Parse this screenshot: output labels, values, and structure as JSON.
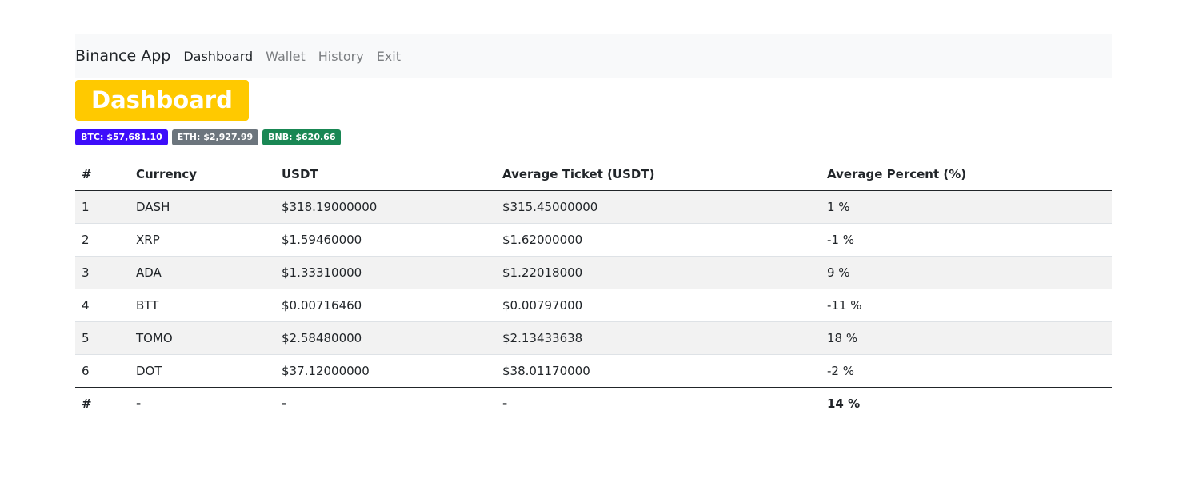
{
  "nav": {
    "brand": "Binance App",
    "links": [
      "Dashboard",
      "Wallet",
      "History",
      "Exit"
    ]
  },
  "page": {
    "title": "Dashboard"
  },
  "tickers": [
    {
      "label": "BTC: $57,681.10",
      "color": "#3d0dfa"
    },
    {
      "label": "ETH: $2,927.99",
      "color": "#6c757d"
    },
    {
      "label": "BNB: $620.66",
      "color": "#198754"
    }
  ],
  "colors": {
    "title_badge": "#ffc900"
  },
  "table": {
    "headers": [
      "#",
      "Currency",
      "USDT",
      "Average Ticket (USDT)",
      "Average Percent (%)"
    ],
    "rows": [
      [
        "1",
        "DASH",
        "$318.19000000",
        "$315.45000000",
        "1 %"
      ],
      [
        "2",
        "XRP",
        "$1.59460000",
        "$1.62000000",
        "-1 %"
      ],
      [
        "3",
        "ADA",
        "$1.33310000",
        "$1.22018000",
        "9 %"
      ],
      [
        "4",
        "BTT",
        "$0.00716460",
        "$0.00797000",
        "-11 %"
      ],
      [
        "5",
        "TOMO",
        "$2.58480000",
        "$2.13433638",
        "18 %"
      ],
      [
        "6",
        "DOT",
        "$37.12000000",
        "$38.01170000",
        "-2 %"
      ]
    ],
    "footer": [
      "#",
      "-",
      "-",
      "-",
      "14 %"
    ]
  }
}
